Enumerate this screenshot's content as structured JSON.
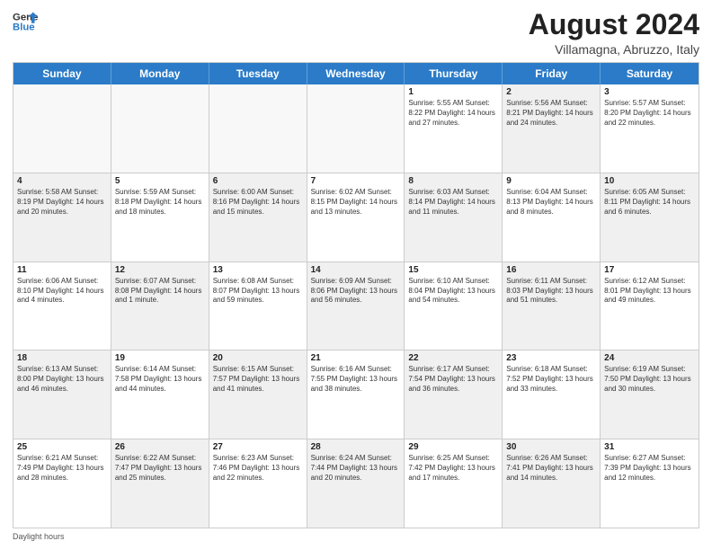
{
  "logo": {
    "line1": "General",
    "line2": "Blue"
  },
  "title": {
    "month_year": "August 2024",
    "location": "Villamagna, Abruzzo, Italy"
  },
  "days_of_week": [
    "Sunday",
    "Monday",
    "Tuesday",
    "Wednesday",
    "Thursday",
    "Friday",
    "Saturday"
  ],
  "footer": {
    "label": "Daylight hours"
  },
  "weeks": [
    [
      {
        "day": "",
        "info": "",
        "empty": true
      },
      {
        "day": "",
        "info": "",
        "empty": true
      },
      {
        "day": "",
        "info": "",
        "empty": true
      },
      {
        "day": "",
        "info": "",
        "empty": true
      },
      {
        "day": "1",
        "info": "Sunrise: 5:55 AM\nSunset: 8:22 PM\nDaylight: 14 hours and 27 minutes."
      },
      {
        "day": "2",
        "info": "Sunrise: 5:56 AM\nSunset: 8:21 PM\nDaylight: 14 hours and 24 minutes.",
        "shaded": true
      },
      {
        "day": "3",
        "info": "Sunrise: 5:57 AM\nSunset: 8:20 PM\nDaylight: 14 hours and 22 minutes."
      }
    ],
    [
      {
        "day": "4",
        "info": "Sunrise: 5:58 AM\nSunset: 8:19 PM\nDaylight: 14 hours and 20 minutes.",
        "shaded": true
      },
      {
        "day": "5",
        "info": "Sunrise: 5:59 AM\nSunset: 8:18 PM\nDaylight: 14 hours and 18 minutes."
      },
      {
        "day": "6",
        "info": "Sunrise: 6:00 AM\nSunset: 8:16 PM\nDaylight: 14 hours and 15 minutes.",
        "shaded": true
      },
      {
        "day": "7",
        "info": "Sunrise: 6:02 AM\nSunset: 8:15 PM\nDaylight: 14 hours and 13 minutes."
      },
      {
        "day": "8",
        "info": "Sunrise: 6:03 AM\nSunset: 8:14 PM\nDaylight: 14 hours and 11 minutes.",
        "shaded": true
      },
      {
        "day": "9",
        "info": "Sunrise: 6:04 AM\nSunset: 8:13 PM\nDaylight: 14 hours and 8 minutes."
      },
      {
        "day": "10",
        "info": "Sunrise: 6:05 AM\nSunset: 8:11 PM\nDaylight: 14 hours and 6 minutes.",
        "shaded": true
      }
    ],
    [
      {
        "day": "11",
        "info": "Sunrise: 6:06 AM\nSunset: 8:10 PM\nDaylight: 14 hours and 4 minutes."
      },
      {
        "day": "12",
        "info": "Sunrise: 6:07 AM\nSunset: 8:08 PM\nDaylight: 14 hours and 1 minute.",
        "shaded": true
      },
      {
        "day": "13",
        "info": "Sunrise: 6:08 AM\nSunset: 8:07 PM\nDaylight: 13 hours and 59 minutes."
      },
      {
        "day": "14",
        "info": "Sunrise: 6:09 AM\nSunset: 8:06 PM\nDaylight: 13 hours and 56 minutes.",
        "shaded": true
      },
      {
        "day": "15",
        "info": "Sunrise: 6:10 AM\nSunset: 8:04 PM\nDaylight: 13 hours and 54 minutes."
      },
      {
        "day": "16",
        "info": "Sunrise: 6:11 AM\nSunset: 8:03 PM\nDaylight: 13 hours and 51 minutes.",
        "shaded": true
      },
      {
        "day": "17",
        "info": "Sunrise: 6:12 AM\nSunset: 8:01 PM\nDaylight: 13 hours and 49 minutes."
      }
    ],
    [
      {
        "day": "18",
        "info": "Sunrise: 6:13 AM\nSunset: 8:00 PM\nDaylight: 13 hours and 46 minutes.",
        "shaded": true
      },
      {
        "day": "19",
        "info": "Sunrise: 6:14 AM\nSunset: 7:58 PM\nDaylight: 13 hours and 44 minutes."
      },
      {
        "day": "20",
        "info": "Sunrise: 6:15 AM\nSunset: 7:57 PM\nDaylight: 13 hours and 41 minutes.",
        "shaded": true
      },
      {
        "day": "21",
        "info": "Sunrise: 6:16 AM\nSunset: 7:55 PM\nDaylight: 13 hours and 38 minutes."
      },
      {
        "day": "22",
        "info": "Sunrise: 6:17 AM\nSunset: 7:54 PM\nDaylight: 13 hours and 36 minutes.",
        "shaded": true
      },
      {
        "day": "23",
        "info": "Sunrise: 6:18 AM\nSunset: 7:52 PM\nDaylight: 13 hours and 33 minutes."
      },
      {
        "day": "24",
        "info": "Sunrise: 6:19 AM\nSunset: 7:50 PM\nDaylight: 13 hours and 30 minutes.",
        "shaded": true
      }
    ],
    [
      {
        "day": "25",
        "info": "Sunrise: 6:21 AM\nSunset: 7:49 PM\nDaylight: 13 hours and 28 minutes."
      },
      {
        "day": "26",
        "info": "Sunrise: 6:22 AM\nSunset: 7:47 PM\nDaylight: 13 hours and 25 minutes.",
        "shaded": true
      },
      {
        "day": "27",
        "info": "Sunrise: 6:23 AM\nSunset: 7:46 PM\nDaylight: 13 hours and 22 minutes."
      },
      {
        "day": "28",
        "info": "Sunrise: 6:24 AM\nSunset: 7:44 PM\nDaylight: 13 hours and 20 minutes.",
        "shaded": true
      },
      {
        "day": "29",
        "info": "Sunrise: 6:25 AM\nSunset: 7:42 PM\nDaylight: 13 hours and 17 minutes."
      },
      {
        "day": "30",
        "info": "Sunrise: 6:26 AM\nSunset: 7:41 PM\nDaylight: 13 hours and 14 minutes.",
        "shaded": true
      },
      {
        "day": "31",
        "info": "Sunrise: 6:27 AM\nSunset: 7:39 PM\nDaylight: 13 hours and 12 minutes."
      }
    ]
  ]
}
